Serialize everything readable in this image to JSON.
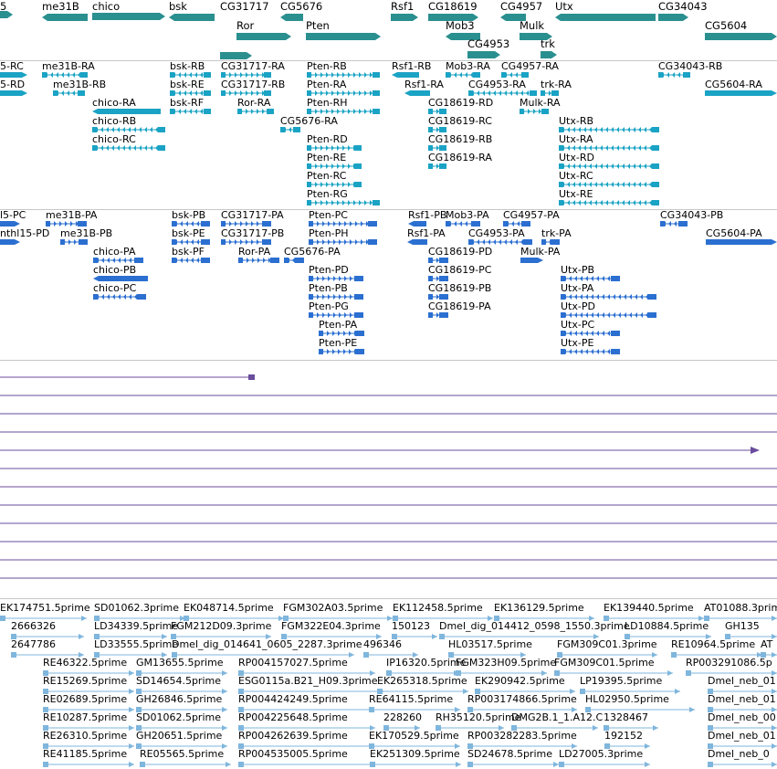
{
  "colors": {
    "gene": "#2a8f8f",
    "transcript": "#1aa3c4",
    "protein": "#2b6fd0",
    "alignment": "#6a4c9c",
    "est": "#7fb6dd",
    "divider": "#c8c8c8"
  },
  "genes": [
    {
      "label": "5",
      "dir": "right"
    },
    {
      "label": "me31B",
      "dir": "left"
    },
    {
      "label": "chico",
      "dir": "right"
    },
    {
      "label": "bsk",
      "dir": "left"
    },
    {
      "label": "CG31717",
      "dir": "right"
    },
    {
      "label": "CG5676",
      "dir": "left"
    },
    {
      "label": "Rsf1",
      "dir": "right"
    },
    {
      "label": "CG18619",
      "dir": "right"
    },
    {
      "label": "CG4957",
      "dir": "left"
    },
    {
      "label": "Utx",
      "dir": "left"
    },
    {
      "label": "CG34043",
      "dir": "right"
    },
    {
      "label": "Ror",
      "dir": "right"
    },
    {
      "label": "Pten",
      "dir": "right"
    },
    {
      "label": "Mob3",
      "dir": "left"
    },
    {
      "label": "Mulk",
      "dir": "right"
    },
    {
      "label": "CG5604",
      "dir": "right"
    },
    {
      "label": "CG4953",
      "dir": "right"
    },
    {
      "label": "trk",
      "dir": "right"
    }
  ],
  "transcripts": [
    "5-RC",
    "me31B-RA",
    "bsk-RB",
    "CG31717-RA",
    "Pten-RB",
    "Rsf1-RB",
    "Mob3-RA",
    "CG4957-RA",
    "CG34043-RB",
    "5-RD",
    "me31B-RB",
    "bsk-RE",
    "CG31717-RB",
    "Pten-RA",
    "Rsf1-RA",
    "CG4953-RA",
    "trk-RA",
    "CG5604-RA",
    "chico-RA",
    "bsk-RF",
    "Ror-RA",
    "Pten-RH",
    "CG18619-RD",
    "Mulk-RA",
    "chico-RB",
    "CG5676-RA",
    "CG18619-RC",
    "Utx-RB",
    "chico-RC",
    "Pten-RD",
    "CG18619-RB",
    "Utx-RA",
    "Pten-RE",
    "CG18619-RA",
    "Utx-RD",
    "Pten-RC",
    "Utx-RC",
    "Pten-RG",
    "Utx-RE"
  ],
  "proteins": [
    "l5-PC",
    "me31B-PA",
    "bsk-PB",
    "CG31717-PA",
    "Pten-PC",
    "Rsf1-PB",
    "Mob3-PA",
    "CG4957-PA",
    "CG34043-PB",
    "nthl15-PD",
    "me31B-PB",
    "bsk-PE",
    "CG31717-PB",
    "Pten-PH",
    "Rsf1-PA",
    "CG4953-PA",
    "trk-PA",
    "CG5604-PA",
    "chico-PA",
    "bsk-PF",
    "Ror-PA",
    "CG5676-PA",
    "CG18619-PD",
    "Mulk-PA",
    "chico-PB",
    "Pten-PD",
    "CG18619-PC",
    "Utx-PB",
    "chico-PC",
    "Pten-PB",
    "CG18619-PB",
    "Utx-PA",
    "Pten-PG",
    "CG18619-PA",
    "Utx-PD",
    "Pten-PA",
    "Utx-PC",
    "Pten-PE",
    "Utx-PE"
  ],
  "est_rows": [
    [
      "EK174751.5prime",
      "SD01062.3prime",
      "EK048714.5prime",
      "FGM302A03.5prime",
      "EK112458.5prime",
      "EK136129.5prime",
      "EK139440.5prime",
      "AT01088.3prime"
    ],
    [
      "2666326",
      "LD34339.5prime",
      "FGM212D09.3prime",
      "FGM322E04.3prime",
      "150123",
      "Dmel_dig_014412_0598_1550.3prime",
      "LD10884.5prime",
      "GH135"
    ],
    [
      "2647786",
      "LD33555.5prime",
      "Dmel_dig_014641_0605_2287.3prime",
      "496346",
      "HL03517.5prime",
      "FGM309C01.3prime",
      "RE10964.5prime",
      "AT"
    ],
    [
      "RE46322.5prime",
      "GM13655.5prime",
      "RP004157027.5prime",
      "IP16320.5prime",
      "FGM323H09.5prime",
      "FGM309C01.5prime",
      "RP003291086.5p"
    ],
    [
      "RE15269.5prime",
      "SD14654.5prime",
      "ESG0115a.B21_H09.3prime",
      "EK265318.5prime",
      "EK290942.5prime",
      "LP19395.5prime",
      "Dmel_neb_01"
    ],
    [
      "RE02689.5prime",
      "GH26846.5prime",
      "RP004424249.5prime",
      "RE64115.5prime",
      "RP003174866.5prime",
      "HL02950.5prime",
      "Dmel_neb_01"
    ],
    [
      "RE10287.5prime",
      "SD01062.5prime",
      "RP004225648.5prime",
      "228260",
      "RH35120.5prime",
      "DMG2B.1_1.A12.C",
      "1328467",
      "Dmel_neb_00"
    ],
    [
      "RE26310.5prime",
      "GH20651.5prime",
      "RP004262639.5prime",
      "EK170529.5prime",
      "RP003282283.5prime",
      "192152",
      "Dmel_neb_01"
    ],
    [
      "RE41185.5prime",
      "RE05565.5prime",
      "RP004535005.5prime",
      "EK251309.5prime",
      "SD24678.5prime",
      "LD27005.3prime",
      "Dmel_neb_0"
    ]
  ]
}
